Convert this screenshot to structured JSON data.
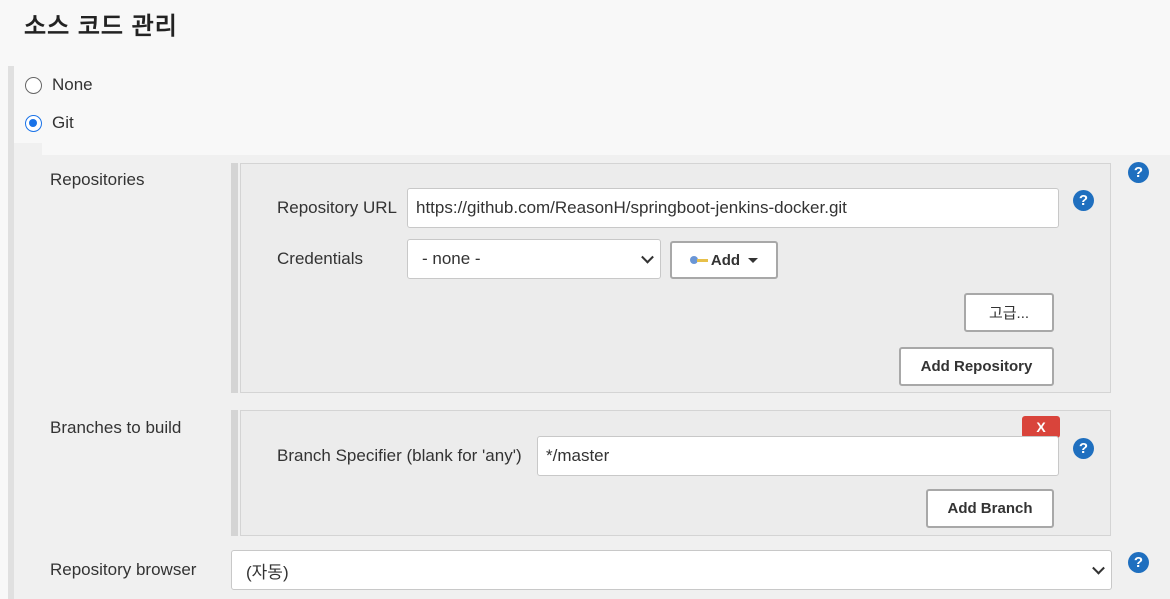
{
  "section": {
    "title": "소스 코드 관리"
  },
  "scm_options": [
    {
      "label": "None",
      "selected": false
    },
    {
      "label": "Git",
      "selected": true
    }
  ],
  "repositories": {
    "label": "Repositories",
    "url_label": "Repository URL",
    "url_value": "https://github.com/ReasonH/springboot-jenkins-docker.git",
    "credentials_label": "Credentials",
    "credentials_value": "- none -",
    "add_label": "Add",
    "advanced_label": "고급...",
    "add_repository_label": "Add Repository"
  },
  "branches": {
    "label": "Branches to build",
    "delete_label": "X",
    "specifier_label": "Branch Specifier (blank for 'any')",
    "specifier_value": "*/master",
    "add_branch_label": "Add Branch"
  },
  "browser": {
    "label": "Repository browser",
    "value": "(자동)"
  },
  "help": {
    "glyph": "?"
  },
  "colors": {
    "accent": "#1f6fbf",
    "radio": "#1a73e8",
    "danger": "#d9443b"
  }
}
